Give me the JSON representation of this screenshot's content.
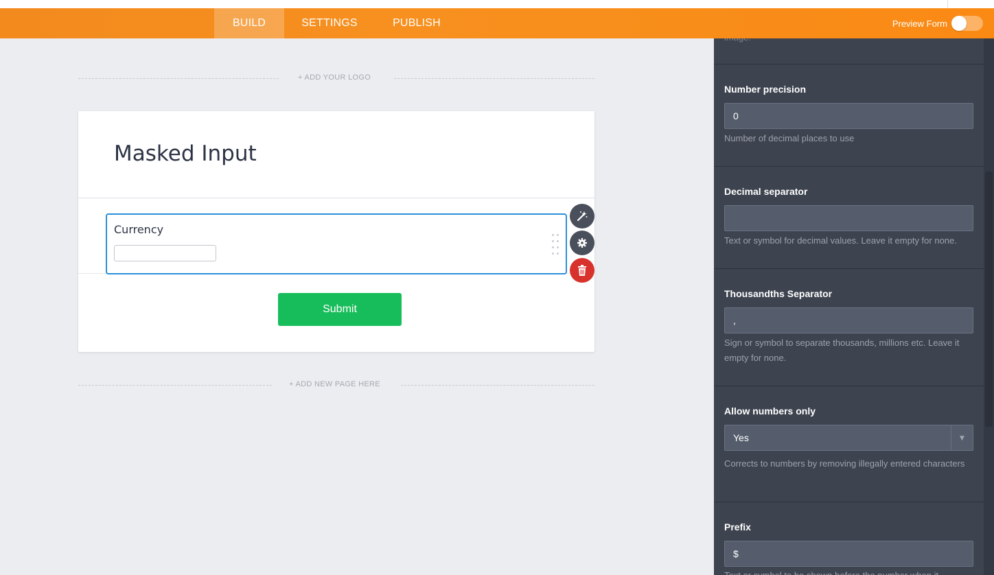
{
  "nav": {
    "tabs": [
      {
        "label": "BUILD",
        "active": true
      },
      {
        "label": "SETTINGS",
        "active": false
      },
      {
        "label": "PUBLISH",
        "active": false
      }
    ],
    "preview_label": "Preview Form",
    "preview_on": false,
    "accent_color": "#f7901f"
  },
  "canvas": {
    "add_logo": "+ ADD YOUR LOGO",
    "add_page": "+ ADD NEW PAGE HERE",
    "form_title": "Masked Input",
    "field": {
      "label": "Currency",
      "value": ""
    },
    "submit_label": "Submit",
    "side_actions": [
      "magic-wand-icon",
      "gear-icon",
      "trash-icon"
    ]
  },
  "panel": {
    "top_fragment": "image.",
    "number_precision": {
      "title": "Number precision",
      "value": "0",
      "help": "Number of decimal places to use"
    },
    "decimal_separator": {
      "title": "Decimal separator",
      "value": "",
      "help": "Text or symbol for decimal values. Leave it empty for none."
    },
    "thousands_separator": {
      "title": "Thousandths Separator",
      "value": ",",
      "help": "Sign or symbol to separate thousands, millions etc. Leave it empty for none."
    },
    "allow_numbers": {
      "title": "Allow numbers only",
      "value": "Yes",
      "help": "Corrects to numbers by removing illegally entered characters"
    },
    "prefix": {
      "title": "Prefix",
      "value": "$",
      "help": "Text or symbol to be shown before the number when it"
    }
  }
}
